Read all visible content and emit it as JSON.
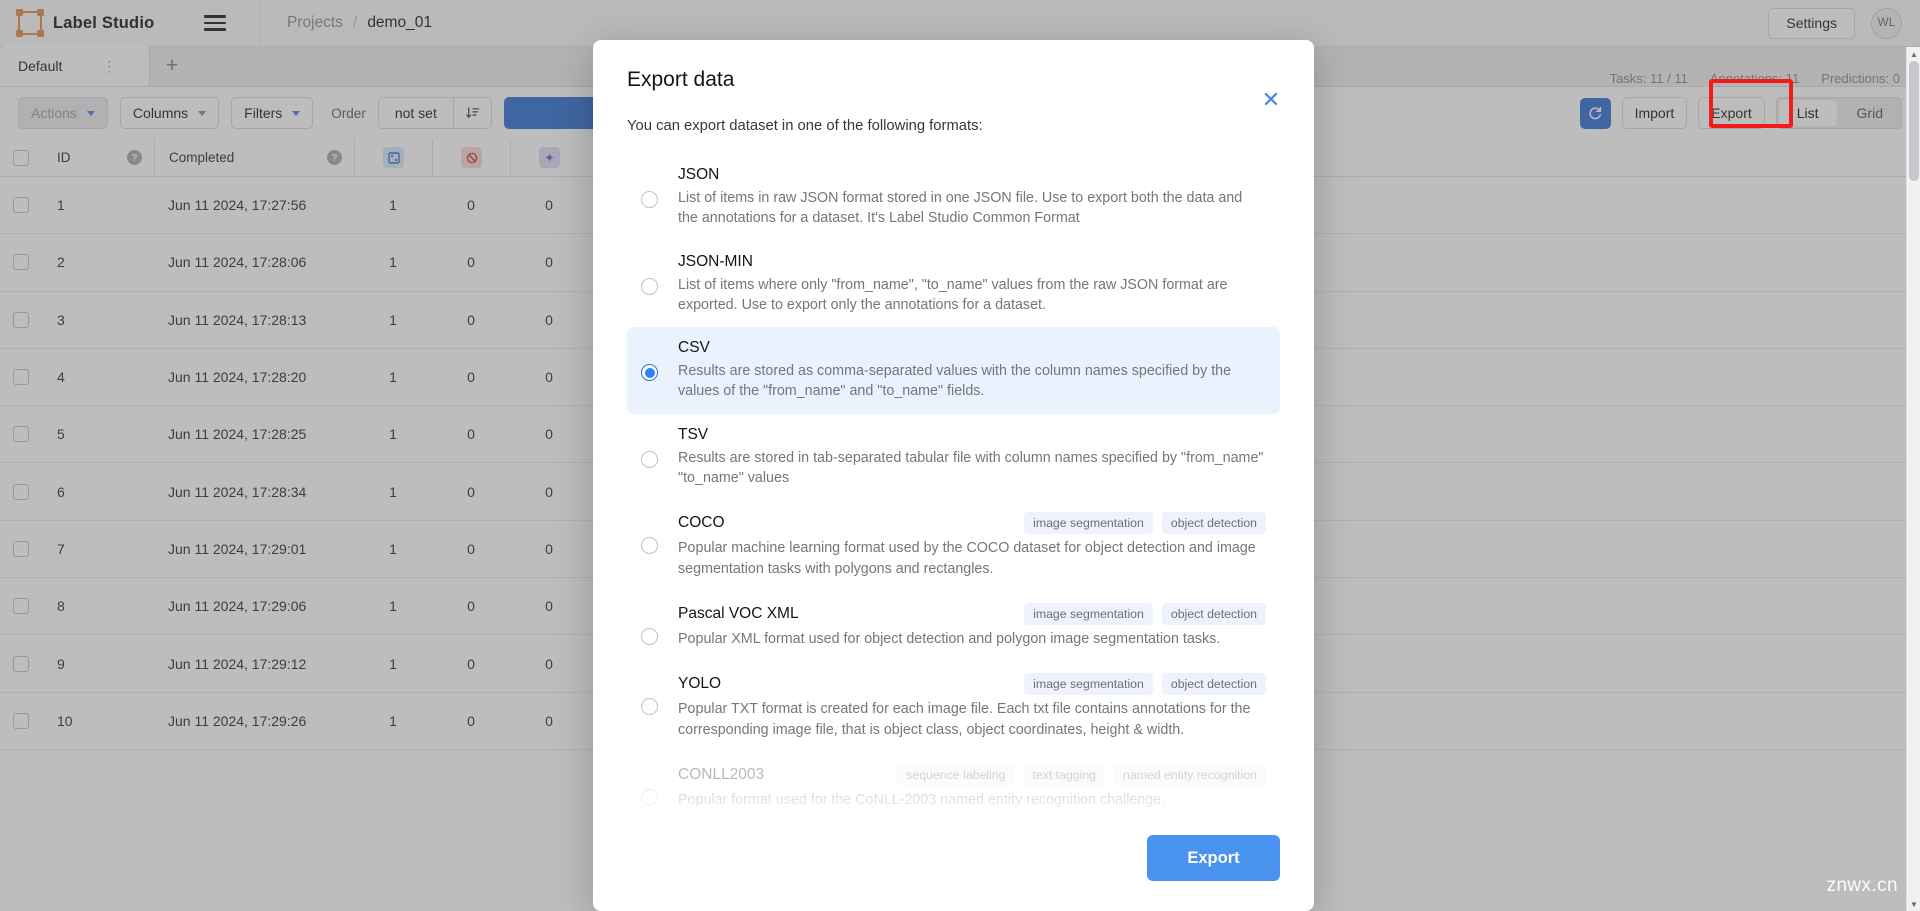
{
  "header": {
    "brand": "Label Studio",
    "logo_icon": "label-studio-logo-icon",
    "menu_icon": "hamburger-menu-icon",
    "breadcrumb": {
      "root": "Projects",
      "separator": "/",
      "current": "demo_01"
    },
    "settings_label": "Settings",
    "avatar_initials": "WL"
  },
  "tabs": {
    "active_label": "Default",
    "kebab_icon": "kebab-menu-icon",
    "add_icon": "plus-icon",
    "stats": [
      "Tasks: 11 / 11",
      "Annotations: 11",
      "Predictions: 0"
    ]
  },
  "toolbar": {
    "actions_label": "Actions",
    "columns_label": "Columns",
    "filters_label": "Filters",
    "order_label": "Order",
    "order_value": "not set",
    "sort_icon": "sort-descending-icon",
    "refresh_icon": "refresh-icon",
    "import_label": "Import",
    "export_label": "Export",
    "view_list_label": "List",
    "view_grid_label": "Grid",
    "highlight_color": "#f41a1a"
  },
  "table": {
    "columns": [
      "ID",
      "Completed"
    ],
    "icon_columns": [
      "annotations-icon",
      "cancelled-icon",
      "predictions-icon"
    ],
    "help_icon": "question-mark-icon",
    "rows": [
      {
        "id": "1",
        "completed": "Jun 11 2024, 17:27:56",
        "annotations": "1",
        "cancelled": "0",
        "predictions": "0"
      },
      {
        "id": "2",
        "completed": "Jun 11 2024, 17:28:06",
        "annotations": "1",
        "cancelled": "0",
        "predictions": "0"
      },
      {
        "id": "3",
        "completed": "Jun 11 2024, 17:28:13",
        "annotations": "1",
        "cancelled": "0",
        "predictions": "0"
      },
      {
        "id": "4",
        "completed": "Jun 11 2024, 17:28:20",
        "annotations": "1",
        "cancelled": "0",
        "predictions": "0"
      },
      {
        "id": "5",
        "completed": "Jun 11 2024, 17:28:25",
        "annotations": "1",
        "cancelled": "0",
        "predictions": "0"
      },
      {
        "id": "6",
        "completed": "Jun 11 2024, 17:28:34",
        "annotations": "1",
        "cancelled": "0",
        "predictions": "0"
      },
      {
        "id": "7",
        "completed": "Jun 11 2024, 17:29:01",
        "annotations": "1",
        "cancelled": "0",
        "predictions": "0"
      },
      {
        "id": "8",
        "completed": "Jun 11 2024, 17:29:06",
        "annotations": "1",
        "cancelled": "0",
        "predictions": "0"
      },
      {
        "id": "9",
        "completed": "Jun 11 2024, 17:29:12",
        "annotations": "1",
        "cancelled": "0",
        "predictions": "0"
      },
      {
        "id": "10",
        "completed": "Jun 11 2024, 17:29:26",
        "annotations": "1",
        "cancelled": "0",
        "predictions": "0"
      }
    ]
  },
  "modal": {
    "title": "Export data",
    "close_icon": "close-icon",
    "subtitle": "You can export dataset in one of the following formats:",
    "selected_format": "CSV",
    "export_button": "Export",
    "formats": [
      {
        "name": "JSON",
        "description": "List of items in raw JSON format stored in one JSON file. Use to export both the data and the annotations for a dataset. It's Label Studio Common Format",
        "tags": [],
        "selected": false,
        "faded": false
      },
      {
        "name": "JSON-MIN",
        "description": "List of items where only \"from_name\", \"to_name\" values from the raw JSON format are exported. Use to export only the annotations for a dataset.",
        "tags": [],
        "selected": false,
        "faded": false
      },
      {
        "name": "CSV",
        "description": "Results are stored as comma-separated values with the column names specified by the values of the \"from_name\" and \"to_name\" fields.",
        "tags": [],
        "selected": true,
        "faded": false
      },
      {
        "name": "TSV",
        "description": "Results are stored in tab-separated tabular file with column names specified by \"from_name\" \"to_name\" values",
        "tags": [],
        "selected": false,
        "faded": false
      },
      {
        "name": "COCO",
        "description": "Popular machine learning format used by the COCO dataset for object detection and image segmentation tasks with polygons and rectangles.",
        "tags": [
          "image segmentation",
          "object detection"
        ],
        "selected": false,
        "faded": false
      },
      {
        "name": "Pascal VOC XML",
        "description": "Popular XML format used for object detection and polygon image segmentation tasks.",
        "tags": [
          "image segmentation",
          "object detection"
        ],
        "selected": false,
        "faded": false
      },
      {
        "name": "YOLO",
        "description": "Popular TXT format is created for each image file. Each txt file contains annotations for the corresponding image file, that is object class, object coordinates, height & width.",
        "tags": [
          "image segmentation",
          "object detection"
        ],
        "selected": false,
        "faded": false
      },
      {
        "name": "CONLL2003",
        "description": "Popular format used for the CoNLL-2003 named entity recognition challenge.",
        "tags": [
          "sequence labeling",
          "text tagging",
          "named entity recognition"
        ],
        "selected": false,
        "faded": true
      }
    ]
  },
  "watermark": "znwx.cn",
  "colors": {
    "accent_blue": "#2f6fd0",
    "export_blue": "#4a92ef",
    "selected_row_bg": "#eaf2fe",
    "highlight_red": "#f41a1a",
    "logo_orange": "#e08a48"
  }
}
